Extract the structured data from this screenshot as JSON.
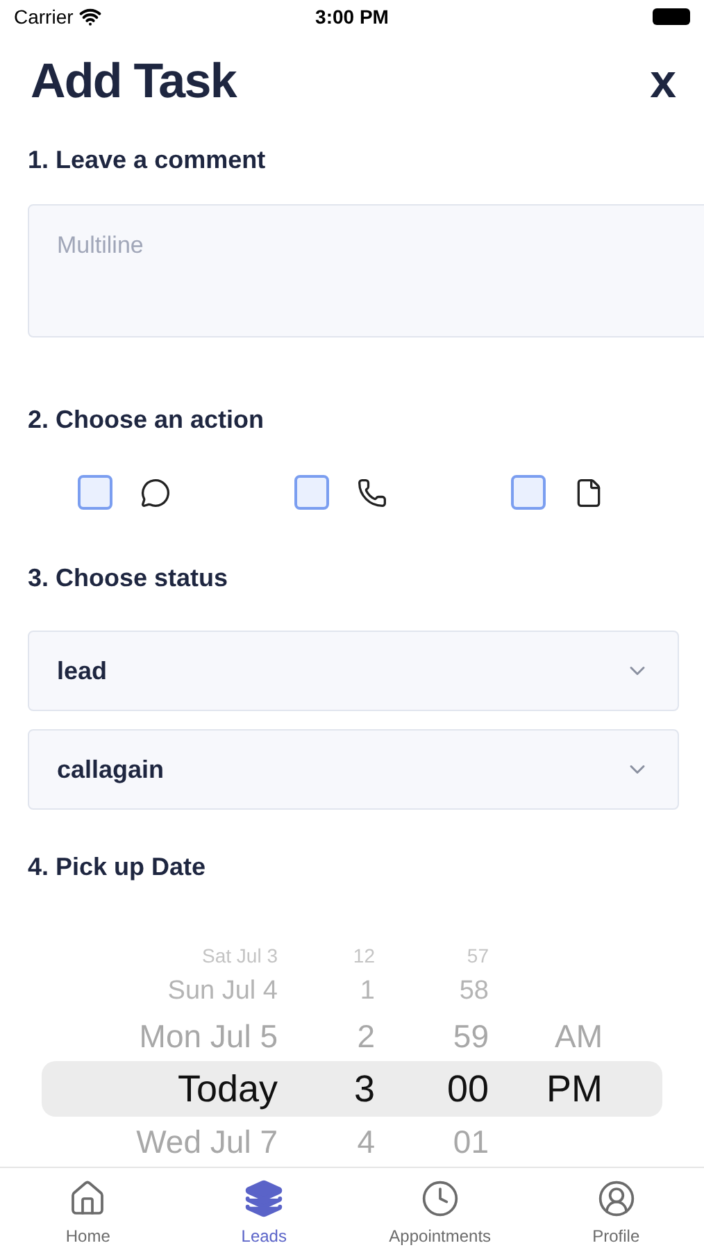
{
  "status_bar": {
    "carrier": "Carrier",
    "time": "3:00 PM"
  },
  "header": {
    "title": "Add Task",
    "close": "x"
  },
  "comment": {
    "label": "1. Leave a comment",
    "placeholder": "Multiline"
  },
  "action": {
    "label": "2. Choose an action",
    "options": [
      {
        "checked": false
      },
      {
        "checked": false
      },
      {
        "checked": false
      }
    ]
  },
  "status": {
    "label": "3. Choose status",
    "selects": [
      {
        "value": "lead"
      },
      {
        "value": "callagain"
      }
    ]
  },
  "date": {
    "label": "4. Pick up Date",
    "rows": [
      {
        "date": "Sat Jul 3",
        "hour": "12",
        "minute": "57",
        "selected": false
      },
      {
        "date": "Sun Jul 4",
        "hour": "1",
        "minute": "58",
        "selected": false
      },
      {
        "date": "Mon Jul 5",
        "hour": "2",
        "minute": "59",
        "period": "AM",
        "selected": false
      },
      {
        "date": "Today",
        "hour": "3",
        "minute": "00",
        "period": "PM",
        "selected": true
      },
      {
        "date": "Wed Jul 7",
        "hour": "4",
        "minute": "01",
        "selected": false
      }
    ]
  },
  "tab_bar": [
    {
      "label": "Home",
      "selected": false
    },
    {
      "label": "Leads",
      "selected": true
    },
    {
      "label": "Appointments",
      "selected": false
    },
    {
      "label": "Profile",
      "selected": false
    }
  ]
}
